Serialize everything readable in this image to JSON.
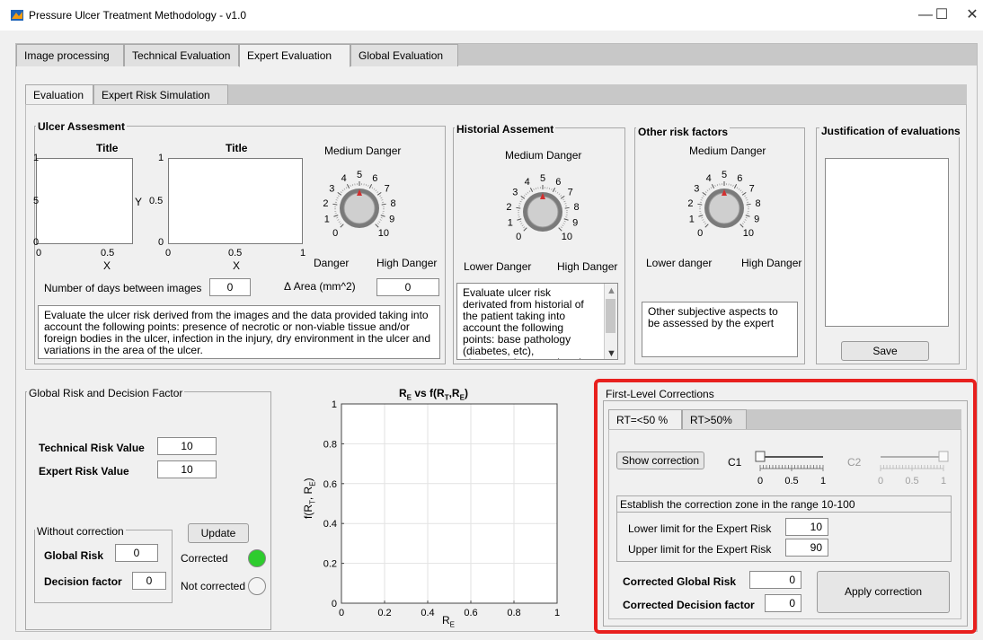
{
  "window": {
    "title": "Pressure Ulcer Treatment Methodology - v1.0",
    "minimize": "—",
    "maximize": "☐",
    "close": "✕"
  },
  "tabs": [
    "Image processing",
    "Technical Evaluation",
    "Expert Evaluation",
    "Global Evaluation"
  ],
  "subtabs": [
    "Evaluation",
    "Expert Risk Simulation"
  ],
  "ulcer": {
    "title": "Ulcer Assesment",
    "plot1": {
      "title": "Title",
      "xlabel": "X",
      "xticks": [
        "0",
        "0.5"
      ],
      "yticks": [
        "1",
        "5",
        "0"
      ]
    },
    "plot2": {
      "title": "Title",
      "xlabel": "X",
      "ylabel": "Y",
      "xticks": [
        "0",
        "0.5",
        "1"
      ],
      "yticks": [
        "1",
        "0.5",
        "0"
      ]
    },
    "knob": {
      "label": "Medium Danger",
      "value": 5,
      "left_label": "Danger",
      "right_label": "High Danger"
    },
    "days_label": "Number of days between images",
    "days_value": "0",
    "area_label": "Δ Area (mm^2)",
    "area_value": "0",
    "description": "Evaluate the ulcer risk derived from the images and the data provided taking into account the following points: presence of necrotic or non-viable tissue and/or foreign bodies in the ulcer, infection in the injury, dry environment in the ulcer and  variations in the area of the ulcer."
  },
  "historial": {
    "title": "Historial Assement",
    "knob": {
      "label": "Medium Danger",
      "value": 5,
      "left_label": "Lower Danger",
      "right_label": "High Danger"
    },
    "description": "Evaluate ulcer risk derivated from historial of the patient taking into account the following points: base pathology (diabetes, etc), pharmacotherapy, chronic"
  },
  "other": {
    "title": "Other risk factors",
    "knob": {
      "label": "Medium Danger",
      "value": 5,
      "left_label": "Lower danger",
      "right_label": "High Danger"
    },
    "description": "Other subjective aspects to be assessed by the expert"
  },
  "justification": {
    "title": "Justification of evaluations",
    "save_label": "Save"
  },
  "knob_ticks": [
    "0",
    "1",
    "2",
    "3",
    "4",
    "5",
    "6",
    "7",
    "8",
    "9",
    "10"
  ],
  "global": {
    "title": "Global Risk and Decision Factor",
    "technical_label": "Technical Risk Value",
    "technical_value": "10",
    "expert_label": "Expert Risk Value",
    "expert_value": "10",
    "without_label": "Without correction",
    "global_risk_label": "Global Risk",
    "global_risk_value": "0",
    "decision_label": "Decision factor",
    "decision_value": "0",
    "update_label": "Update",
    "corrected_label": "Corrected",
    "not_corrected_label": "Not corrected",
    "led_on_color": "#2ecc2e",
    "led_off_color": "#f4f4f4"
  },
  "chart": {
    "title_main": "R",
    "title_sub_e": "E",
    "title_vs": " vs f(R",
    "title_sub_t": "T",
    "title_comma": ",R",
    "title_close": ")",
    "xlabel": "R",
    "xlabel_sub": "E",
    "ylabel": "f(R",
    "ylabel_sub_t": "T",
    "ylabel_mid": ", R",
    "ylabel_sub_e": "E",
    "ylabel_close": ")",
    "xticks": [
      "0",
      "0.2",
      "0.4",
      "0.6",
      "0.8",
      "1"
    ],
    "yticks": [
      "0",
      "0.2",
      "0.4",
      "0.6",
      "0.8",
      "1"
    ]
  },
  "chart_data": {
    "type": "line",
    "title": "R_E vs f(R_T,R_E)",
    "xlabel": "R_E",
    "ylabel": "f(R_T, R_E)",
    "xlim": [
      0,
      1
    ],
    "ylim": [
      0,
      1
    ],
    "grid": true,
    "series": []
  },
  "corrections": {
    "title": "First-Level Corrections",
    "tabs": [
      "RT=<50 %",
      "RT>50%"
    ],
    "show_label": "Show correction",
    "c1_label": "C1",
    "c2_label": "C2",
    "c1_value": 0,
    "c2_value": 1,
    "slider_ticks": [
      "0",
      "0.5",
      "1"
    ],
    "zone_label": "Establish the correction zone in the range 10-100",
    "lower_label": "Lower limit for the Expert Risk",
    "lower_value": "10",
    "upper_label": "Upper limit for the Expert Risk",
    "upper_value": "90",
    "corrected_global_label": "Corrected Global Risk",
    "corrected_global_value": "0",
    "corrected_decision_label": "Corrected Decision factor",
    "corrected_decision_value": "0",
    "apply_label": "Apply correction",
    "highlight_color": "#e8201e"
  }
}
